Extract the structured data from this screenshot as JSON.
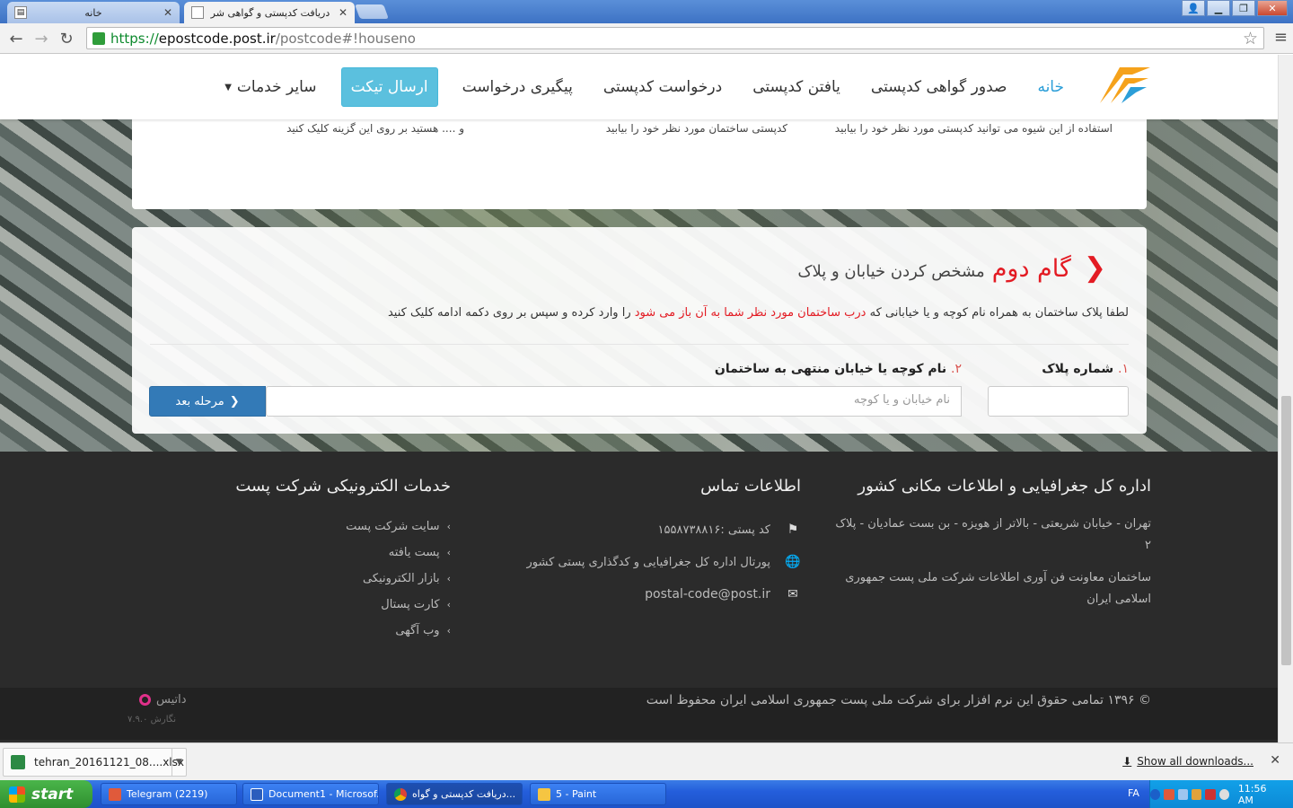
{
  "browser": {
    "tabs": [
      {
        "title": "خانه",
        "active": false
      },
      {
        "title": "دریافت کدپستی و گواهی شر",
        "active": true
      }
    ],
    "url_scheme": "https://",
    "url_host": "epostcode.post.ir",
    "url_path": "/postcode#!houseno"
  },
  "nav": {
    "home": "خانه",
    "items": [
      "صدور گواهی کدپستی",
      "یافتن کدپستی",
      "درخواست کدپستی",
      "پیگیری درخواست"
    ],
    "ticket": "ارسال تیکت",
    "more": "سایر خدمات"
  },
  "top_card": {
    "frag_right": "استفاده از این شیوه می توانید کدپستی مورد نظر خود را بیابید",
    "frag_middle": "کدپستی ساختمان مورد نظر خود را بیابید",
    "frag_left": "و .... هستید بر روی این گزینه کلیک کنید"
  },
  "step": {
    "title": "گام دوم",
    "subtitle": "مشخص کردن خیابان و پلاک",
    "instruction_a": "لطفا پلاک ساختمان به همراه نام کوچه و یا خیابانی که",
    "instruction_hl": "درب ساختمان مورد نظر شما به آن باز می شود",
    "instruction_b": "را وارد کرده و سپس بر روی دکمه ادامه کلیک کنید",
    "label1_num": "۱.",
    "label1": "شماره پلاک",
    "label2_num": "۲.",
    "label2": "نام کوچه یا خیابان منتهی به ساختمان",
    "street_placeholder": "نام خیابان و یا کوچه",
    "next": "مرحله بعد"
  },
  "footer": {
    "col1_title": "اداره کل جغرافیایی و اطلاعات مکانی کشور",
    "col1_addr": "تهران - خیابان شریعتی - بالاتر از هویزه - بن بست عمادیان - پلاک ۲",
    "col1_building": "ساختمان معاونت فن آوری اطلاعات شرکت ملی پست جمهوری اسلامی ایران",
    "col2_title": "اطلاعات تماس",
    "col2_postal": "کد پستی :۱۵۵۸۷۳۸۸۱۶",
    "col2_portal": "پورتال اداره کل جغرافیایی و کدگذاری پستی کشور",
    "col2_email": "postal-code@post.ir",
    "col3_title": "خدمات الکترونیکی شرکت پست",
    "col3_links": [
      "سایت شرکت پست",
      "پست یافته",
      "بازار الکترونیکی",
      "کارت پستال",
      "وب آگهی"
    ],
    "copyright": "© ۱۳۹۶ تمامی حقوق این نرم افزار برای شرکت ملی پست جمهوری اسلامی ایران محفوظ است",
    "brand": "داتیس",
    "version": "نگارش ۷.۹.۰"
  },
  "downloads": {
    "file": "tehran_20161121_08....xlsx",
    "show_all": "Show all downloads..."
  },
  "taskbar": {
    "start": "start",
    "tasks": [
      "Telegram (2219)",
      "Document1 - Microsof...",
      "دریافت کدپستی و گواه...",
      "5 - Paint"
    ],
    "lang": "FA",
    "clock": "11:56 AM"
  },
  "colors": {
    "accent_red": "#e31b23",
    "primary_blue": "#337ab7",
    "info": "#5bc0de",
    "footer_bg": "#2b2b2b"
  }
}
